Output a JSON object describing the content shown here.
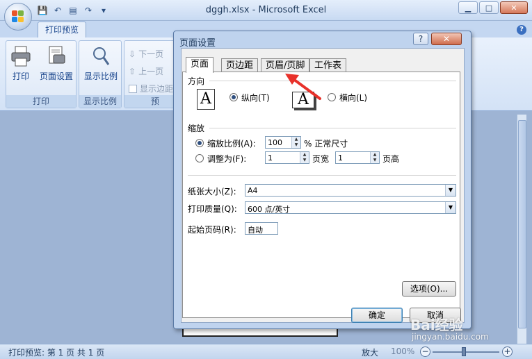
{
  "window": {
    "title": "dggh.xlsx - Microsoft Excel",
    "controls": [
      "minimize",
      "maximize",
      "close"
    ]
  },
  "ribbon": {
    "tab": "打印预览",
    "groups": [
      {
        "name": "打印",
        "buttons": [
          "打印",
          "页面设置"
        ]
      },
      {
        "name": "显示比例",
        "buttons": [
          "显示比例"
        ]
      },
      {
        "name": "预",
        "buttons": [
          "下一页",
          "上一页",
          "显示边距"
        ]
      }
    ]
  },
  "dialog": {
    "title": "页面设置",
    "tabs": [
      "页面",
      "页边距",
      "页眉/页脚",
      "工作表"
    ],
    "active_tab": "页面",
    "orientation": {
      "label": "方向",
      "portrait": "纵向(T)",
      "landscape": "横向(L)",
      "selected": "portrait"
    },
    "scaling": {
      "label": "缩放",
      "scale_option": "缩放比例(A):",
      "scale_value": "100",
      "scale_unit": "% 正常尺寸",
      "fit_option": "调整为(F):",
      "fit_wide_value": "1",
      "fit_wide_unit": "页宽",
      "fit_tall_value": "1",
      "fit_tall_unit": "页高"
    },
    "paper_size": {
      "label": "纸张大小(Z):",
      "value": "A4"
    },
    "print_quality": {
      "label": "打印质量(Q):",
      "value": "600 点/英寸"
    },
    "first_page": {
      "label": "起始页码(R):",
      "value": "自动"
    },
    "options_button": "选项(O)...",
    "ok_button": "确定",
    "cancel_button": "取消"
  },
  "statusbar": {
    "text": "打印预览: 第 1 页 共 1 页",
    "zoom_label": "放大",
    "zoom_value": "100%"
  },
  "watermark": {
    "brand": "Bai经验",
    "url": "jingyan.baidu.com"
  },
  "colors": {
    "accent": "#15428b",
    "annotation_arrow": "#e8312a"
  }
}
